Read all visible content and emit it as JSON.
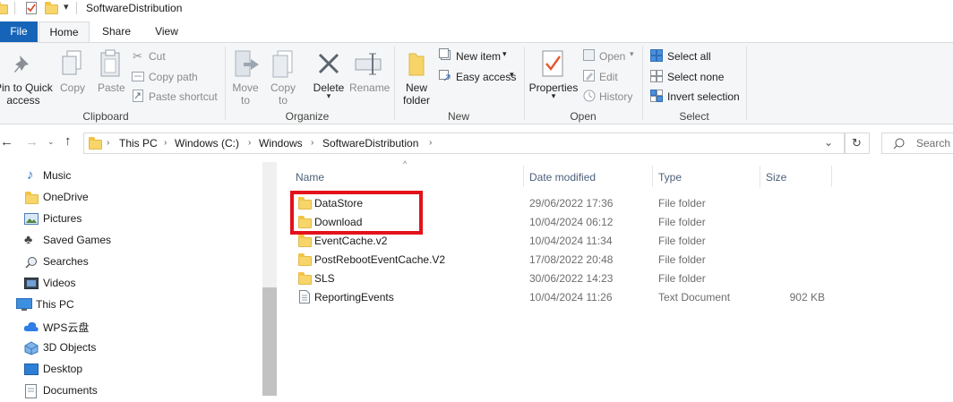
{
  "window": {
    "title": "SoftwareDistribution"
  },
  "tabs": [
    {
      "label": "File"
    },
    {
      "label": "Home"
    },
    {
      "label": "Share"
    },
    {
      "label": "View"
    }
  ],
  "ribbon": {
    "clipboard": {
      "pin_line1": "Pin to Quick",
      "pin_line2": "access",
      "copy": "Copy",
      "paste": "Paste",
      "cut": "Cut",
      "copy_path": "Copy path",
      "paste_shortcut": "Paste shortcut",
      "label": "Clipboard"
    },
    "organize": {
      "move_to_1": "Move",
      "move_to_2": "to",
      "copy_to_1": "Copy",
      "copy_to_2": "to",
      "delete": "Delete",
      "rename": "Rename",
      "label": "Organize"
    },
    "new": {
      "new_folder_1": "New",
      "new_folder_2": "folder",
      "new_item": "New item",
      "easy_access": "Easy access",
      "label": "New"
    },
    "open": {
      "properties": "Properties",
      "open": "Open",
      "edit": "Edit",
      "history": "History",
      "label": "Open"
    },
    "select": {
      "select_all": "Select all",
      "select_none": "Select none",
      "invert_selection": "Invert selection",
      "label": "Select"
    }
  },
  "address": {
    "crumbs": [
      "This PC",
      "Windows (C:)",
      "Windows",
      "SoftwareDistribution"
    ],
    "search_placeholder": "Search S"
  },
  "nav_pane": {
    "items": [
      {
        "label": "Music",
        "icon": "music-icon"
      },
      {
        "label": "OneDrive",
        "icon": "folder-icon"
      },
      {
        "label": "Pictures",
        "icon": "pictures-icon"
      },
      {
        "label": "Saved Games",
        "icon": "saved-games-icon"
      },
      {
        "label": "Searches",
        "icon": "search-icon"
      },
      {
        "label": "Videos",
        "icon": "videos-icon"
      },
      {
        "label": "This PC",
        "icon": "computer-icon"
      },
      {
        "label": "WPS云盘",
        "icon": "cloud-drive-icon"
      },
      {
        "label": "3D Objects",
        "icon": "3d-objects-icon"
      },
      {
        "label": "Desktop",
        "icon": "desktop-icon"
      },
      {
        "label": "Documents",
        "icon": "documents-icon"
      }
    ]
  },
  "file_list": {
    "columns": {
      "name": "Name",
      "date": "Date modified",
      "type": "Type",
      "size": "Size"
    },
    "rows": [
      {
        "name": "DataStore",
        "date": "29/06/2022 17:36",
        "type": "File folder",
        "size": "",
        "kind": "folder"
      },
      {
        "name": "Download",
        "date": "10/04/2024 06:12",
        "type": "File folder",
        "size": "",
        "kind": "folder"
      },
      {
        "name": "EventCache.v2",
        "date": "10/04/2024 11:34",
        "type": "File folder",
        "size": "",
        "kind": "folder"
      },
      {
        "name": "PostRebootEventCache.V2",
        "date": "17/08/2022 20:48",
        "type": "File folder",
        "size": "",
        "kind": "folder"
      },
      {
        "name": "SLS",
        "date": "30/06/2022 14:23",
        "type": "File folder",
        "size": "",
        "kind": "folder"
      },
      {
        "name": "ReportingEvents",
        "date": "10/04/2024 11:26",
        "type": "Text Document",
        "size": "902 KB",
        "kind": "text"
      }
    ]
  },
  "colors": {
    "file_tab": "#1664b8",
    "highlight": "#e3111b",
    "folder": "#f7d56a"
  }
}
